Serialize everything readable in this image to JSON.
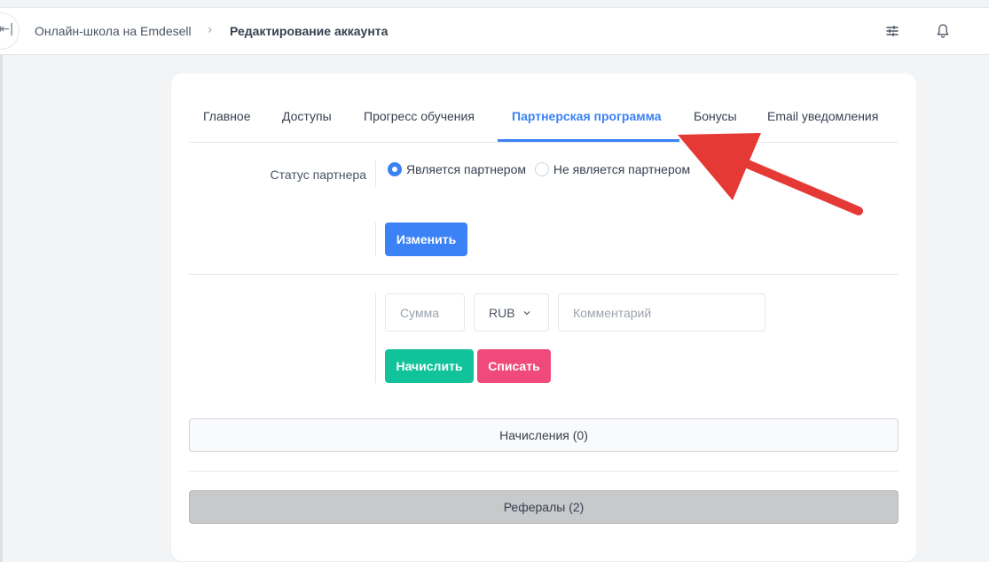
{
  "header": {
    "collapse_glyph": "⇤|",
    "breadcrumb_root": "Онлайн-школа на Emdesell",
    "breadcrumb_sep": "›",
    "breadcrumb_current": "Редактирование аккаунта",
    "icons": [
      "sliders-icon",
      "bell-icon"
    ]
  },
  "tabs": [
    {
      "label": "Главное"
    },
    {
      "label": "Доступы"
    },
    {
      "label": "Прогресс обучения"
    },
    {
      "label": "Партнерская программа",
      "active": true
    },
    {
      "label": "Бонусы"
    },
    {
      "label": "Email уведомления"
    }
  ],
  "partner": {
    "status_label": "Статус партнера",
    "option_yes": "Является партнером",
    "option_no": "Не является партнером",
    "selected": "yes",
    "change_button": "Изменить"
  },
  "balance": {
    "amount_placeholder": "Сумма",
    "currency": "RUB",
    "comment_placeholder": "Комментарий",
    "credit_button": "Начислить",
    "debit_button": "Списать"
  },
  "sections": {
    "accruals": "Начисления (0)",
    "referrals": "Рефералы (2)"
  },
  "colors": {
    "accent": "#3b82f6",
    "success": "#10c39b",
    "danger": "#f04a7a",
    "annotation_arrow": "#e53935"
  }
}
